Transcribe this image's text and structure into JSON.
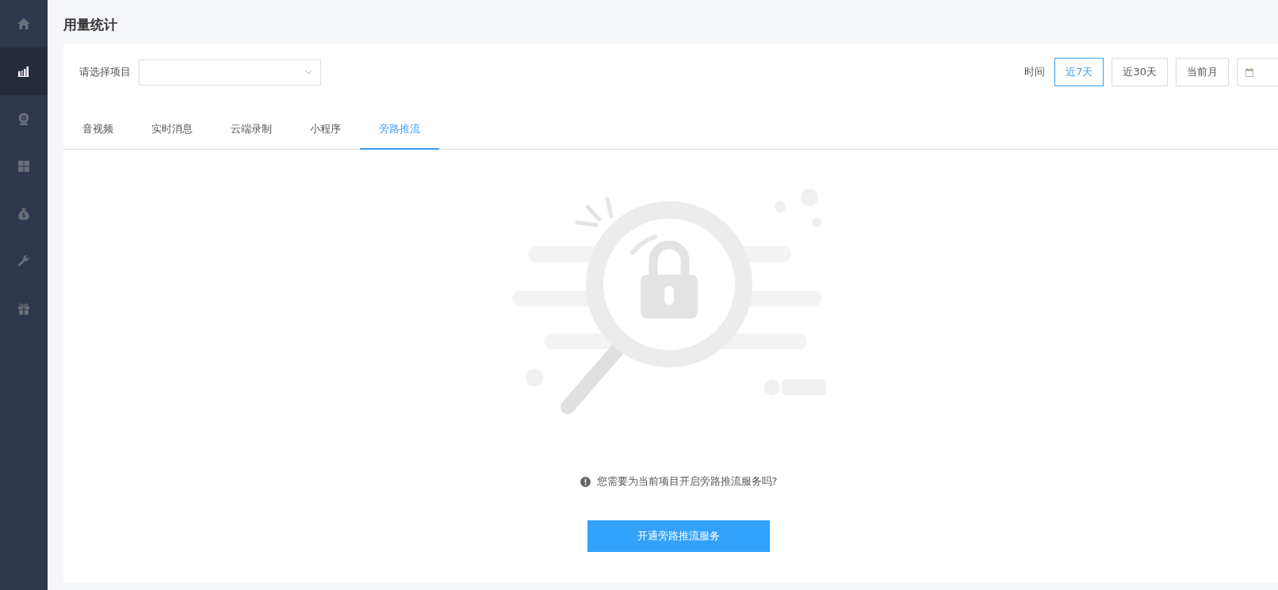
{
  "sidebar": {
    "items": [
      {
        "kind": "home",
        "selected": false
      },
      {
        "kind": "chart",
        "selected": true
      },
      {
        "kind": "webcam",
        "selected": false
      },
      {
        "kind": "grid",
        "selected": false
      },
      {
        "kind": "money",
        "selected": false
      },
      {
        "kind": "wrench",
        "selected": false
      },
      {
        "kind": "gift",
        "selected": false
      }
    ]
  },
  "page_title": "用量统计",
  "filters": {
    "project_label": "请选择项目",
    "time_label": "时间",
    "time_options": [
      {
        "label": "近7天",
        "selected": true
      },
      {
        "label": "近30天",
        "selected": false
      },
      {
        "label": "当前月",
        "selected": false
      }
    ]
  },
  "tabs": [
    {
      "label": "音视频",
      "selected": false
    },
    {
      "label": "实时消息",
      "selected": false
    },
    {
      "label": "云端录制",
      "selected": false
    },
    {
      "label": "小程序",
      "selected": false
    },
    {
      "label": "旁路推流",
      "selected": true
    }
  ],
  "empty_state": {
    "message": "您需要为当前项目开启旁路推流服务吗?",
    "button": "开通旁路推流服务"
  }
}
